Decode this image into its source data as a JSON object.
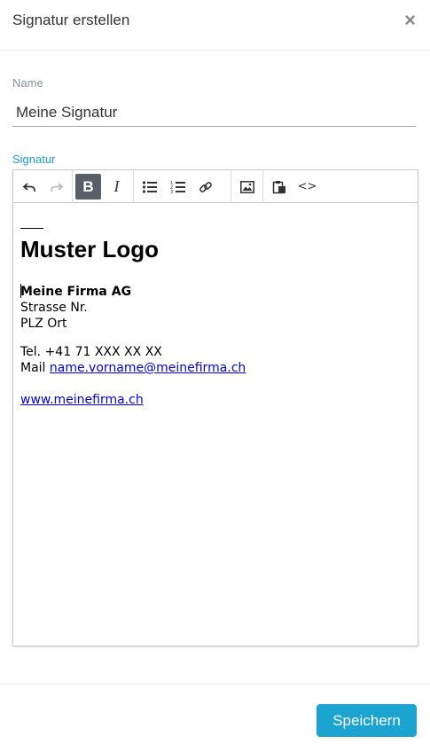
{
  "dialog": {
    "title": "Signatur erstellen",
    "close_glyph": "×"
  },
  "name_field": {
    "label": "Name",
    "value": "Meine Signatur"
  },
  "signature_field": {
    "label": "Signatur"
  },
  "toolbar": {
    "buttons": [
      {
        "name": "undo-button",
        "icon": "undo-icon"
      },
      {
        "name": "redo-button",
        "icon": "redo-icon"
      },
      {
        "name": "bold-button",
        "icon": "bold-icon",
        "active": true,
        "glyph": "B"
      },
      {
        "name": "italic-button",
        "icon": "italic-icon",
        "glyph": "I"
      },
      {
        "name": "bullet-list-button",
        "icon": "bullet-list-icon"
      },
      {
        "name": "numbered-list-button",
        "icon": "numbered-list-icon"
      },
      {
        "name": "link-button",
        "icon": "link-icon"
      },
      {
        "name": "image-button",
        "icon": "image-icon"
      },
      {
        "name": "paste-button",
        "icon": "clipboard-icon"
      },
      {
        "name": "source-code-button",
        "icon": "code-icon",
        "glyph": "<>"
      }
    ]
  },
  "signature": {
    "logo": "Muster Logo",
    "company": "Meine Firma AG",
    "street": "Strasse Nr.",
    "city": "PLZ Ort",
    "tel": "Tel. +41 71 XXX XX XX",
    "mail_prefix": "Mail ",
    "email": "name.vorname@meinefirma.ch",
    "website": "www.meinefirma.ch"
  },
  "footer": {
    "save_label": "Speichern"
  },
  "colors": {
    "accent": "#1ba4cf",
    "label_accent": "#1b9fc9",
    "active_tool": "#585f67"
  }
}
